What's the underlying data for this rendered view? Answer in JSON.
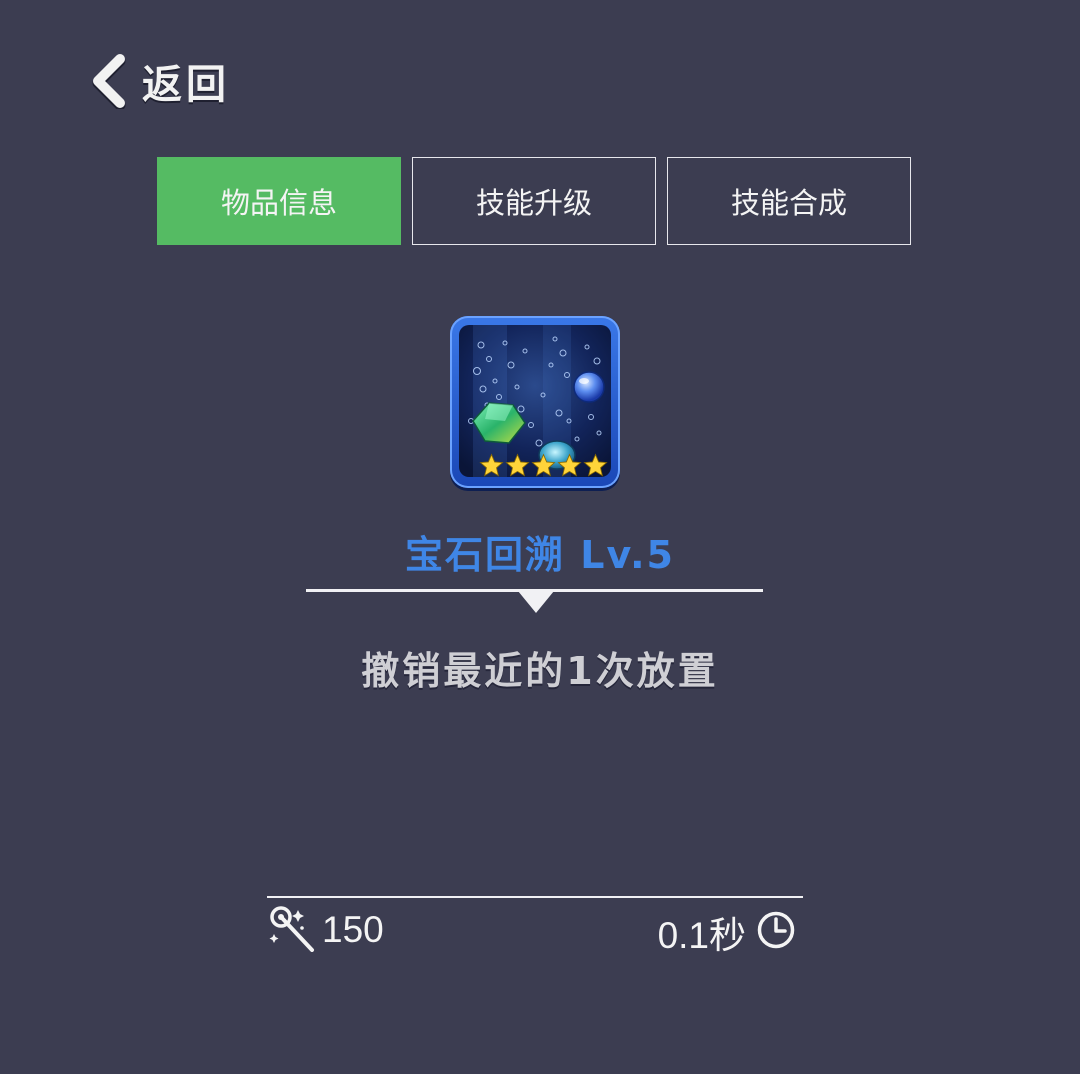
{
  "header": {
    "back_label": "返回",
    "back_icon": "chevron-left-icon"
  },
  "tabs": [
    {
      "label": "物品信息",
      "active": true
    },
    {
      "label": "技能升级",
      "active": false
    },
    {
      "label": "技能合成",
      "active": false
    }
  ],
  "item": {
    "icon": "gem-rewind-icon",
    "stars": 5,
    "name": "宝石回溯 Lv.5",
    "description": "撤销最近的1次放置"
  },
  "footer": {
    "cost_icon": "magic-wand-icon",
    "cost_value": "150",
    "duration_value": "0.1秒",
    "duration_icon": "clock-icon"
  },
  "colors": {
    "background": "#3c3d51",
    "active_tab": "#55bb63",
    "item_name": "#3f86e6",
    "icon_frame": "#2a62d6",
    "star": "#ffd43a"
  }
}
